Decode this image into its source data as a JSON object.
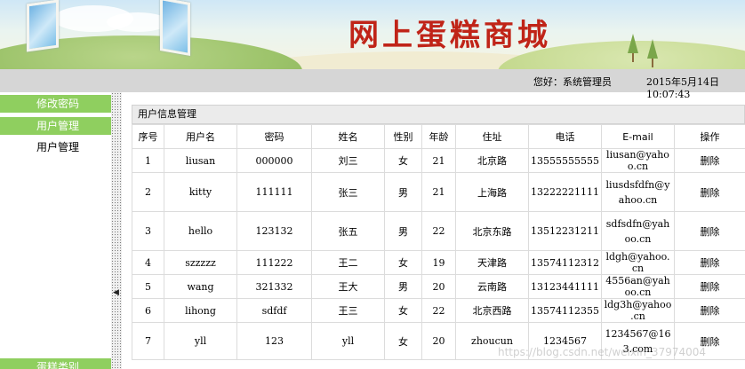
{
  "site": {
    "title": "网上蛋糕商城"
  },
  "status": {
    "greeting": "您好：系统管理员",
    "datetime": "2015年5月14日 10:07:43"
  },
  "sidebar": {
    "items": [
      {
        "label": "修改密码"
      },
      {
        "label": "用户管理"
      },
      {
        "label": "用户管理"
      },
      {
        "label": "蛋糕类别"
      }
    ]
  },
  "panel": {
    "title": "用户信息管理"
  },
  "table": {
    "columns": [
      "序号",
      "用户名",
      "密码",
      "姓名",
      "性别",
      "年龄",
      "住址",
      "电话",
      "E-mail",
      "操作"
    ],
    "rows": [
      {
        "id": "1",
        "username": "liusan",
        "password": "000000",
        "name": "刘三",
        "gender": "女",
        "age": "21",
        "address": "北京路",
        "phone": "13555555555",
        "email": "liusan@yahoo.cn",
        "action": "删除"
      },
      {
        "id": "2",
        "username": "kitty",
        "password": "111111",
        "name": "张三",
        "gender": "男",
        "age": "21",
        "address": "上海路",
        "phone": "13222221111",
        "email": "liusdsfdfn@yahoo.cn",
        "action": "删除"
      },
      {
        "id": "3",
        "username": "hello",
        "password": "123132",
        "name": "张五",
        "gender": "男",
        "age": "22",
        "address": "北京东路",
        "phone": "13512231211",
        "email": "sdfsdfn@yahoo.cn",
        "action": "删除"
      },
      {
        "id": "4",
        "username": "szzzzz",
        "password": "111222",
        "name": "王二",
        "gender": "女",
        "age": "19",
        "address": "天津路",
        "phone": "13574112312",
        "email": "ldgh@yahoo.cn",
        "action": "删除"
      },
      {
        "id": "5",
        "username": "wang",
        "password": "321332",
        "name": "王大",
        "gender": "男",
        "age": "20",
        "address": "云南路",
        "phone": "13123441111",
        "email": "4556an@yahoo.cn",
        "action": "删除"
      },
      {
        "id": "6",
        "username": "lihong",
        "password": "sdfdf",
        "name": "王三",
        "gender": "女",
        "age": "22",
        "address": "北京西路",
        "phone": "13574112355",
        "email": "ldg3h@yahoo.cn",
        "action": "删除"
      },
      {
        "id": "7",
        "username": "yll",
        "password": "123",
        "name": "yll",
        "gender": "女",
        "age": "20",
        "address": "zhoucun",
        "phone": "1234567",
        "email": "1234567@163.com",
        "action": "删除"
      }
    ]
  },
  "watermark": "https://blog.csdn.net/weixin_37974004",
  "colors": {
    "accent_green": "#8fcf5f",
    "title_red": "#c02418",
    "statusbar_gray": "#d6d6d6"
  }
}
